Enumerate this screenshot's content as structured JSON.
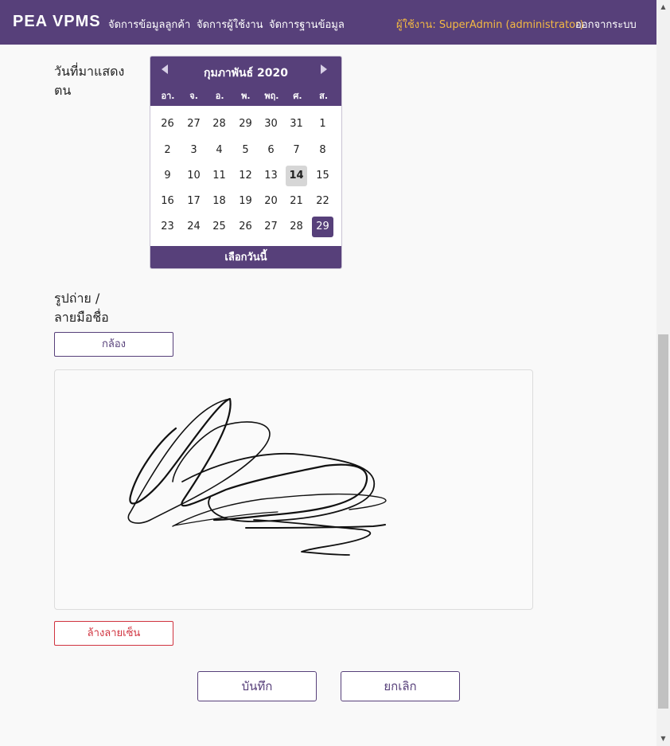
{
  "nav": {
    "brand": "PEA VPMS",
    "links": [
      "จัดการข้อมูลลูกค้า",
      "จัดการผู้ใช้งาน",
      "จัดการฐานข้อมูล"
    ],
    "user": "ผู้ใช้งาน: SuperAdmin (administrator)",
    "logout": "ออกจากระบบ"
  },
  "form": {
    "date_label_line1": "วันที่มาแสดง",
    "date_label_line2": "ตน",
    "photo_label_line1": "รูปถ่าย /",
    "photo_label_line2": "ลายมือชื่อ",
    "camera_button": "กล้อง",
    "clear_signature_button": "ล้างลายเซ็น",
    "save_button": "บันทึก",
    "cancel_button": "ยกเลิก"
  },
  "calendar": {
    "title": "กุมภาพันธ์ 2020",
    "weekdays": [
      "อา.",
      "จ.",
      "อ.",
      "พ.",
      "พฤ.",
      "ศ.",
      "ส."
    ],
    "weeks": [
      [
        "26",
        "27",
        "28",
        "29",
        "30",
        "31",
        "1"
      ],
      [
        "2",
        "3",
        "4",
        "5",
        "6",
        "7",
        "8"
      ],
      [
        "9",
        "10",
        "11",
        "12",
        "13",
        "14",
        "15"
      ],
      [
        "16",
        "17",
        "18",
        "19",
        "20",
        "21",
        "22"
      ],
      [
        "23",
        "24",
        "25",
        "26",
        "27",
        "28",
        "29"
      ]
    ],
    "today": "14",
    "selected": "29",
    "footer": "เลือกวันนี้"
  },
  "colors": {
    "primary": "#57407a",
    "user_highlight": "#f4b942",
    "danger": "#d0333f"
  }
}
